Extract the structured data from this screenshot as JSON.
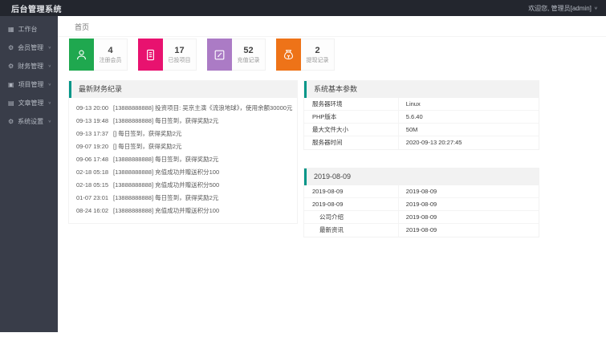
{
  "topbar": {
    "title": "后台管理系统",
    "welcome": "欢迎您, 管理员[admin]",
    "caret": "∨"
  },
  "sidebar": {
    "chevron": "∨",
    "items": [
      {
        "glyph": "▦",
        "label": "工作台"
      },
      {
        "glyph": "⚙",
        "label": "会员管理"
      },
      {
        "glyph": "⚙",
        "label": "财务管理"
      },
      {
        "glyph": "▣",
        "label": "项目管理"
      },
      {
        "glyph": "▤",
        "label": "文章管理"
      },
      {
        "glyph": "⚙",
        "label": "系统设置"
      }
    ]
  },
  "breadcrumb": "首页",
  "stat_cards": [
    {
      "value": "4",
      "label": "注册会员",
      "color": "#1fa84f",
      "icon": "user-icon"
    },
    {
      "value": "17",
      "label": "已投项目",
      "color": "#e8126f",
      "icon": "document-icon"
    },
    {
      "value": "52",
      "label": "充值记录",
      "color": "#ab7bc5",
      "icon": "edit-icon"
    },
    {
      "value": "2",
      "label": "提现记录",
      "color": "#ee7318",
      "icon": "money-bag-icon"
    }
  ],
  "accent_color": "#009688",
  "finance_panel": {
    "title": "最新财务纪录",
    "records": [
      {
        "time": "09-13 20:00",
        "text": "[13888888888] 投资项目: 吴京主演《流浪地球》，使用余额30000元"
      },
      {
        "time": "09-13 19:48",
        "text": "[13888888888] 每日签到，获得奖励2元"
      },
      {
        "time": "09-13 17:37",
        "text": "[] 每日签到，获得奖励2元"
      },
      {
        "time": "09-07 19:20",
        "text": "[] 每日签到，获得奖励2元"
      },
      {
        "time": "09-06 17:48",
        "text": "[13888888888] 每日签到，获得奖励2元"
      },
      {
        "time": "02-18 05:18",
        "text": "[13888888888] 充值成功并赠送积分100"
      },
      {
        "time": "02-18 05:15",
        "text": "[13888888888] 充值成功并赠送积分500"
      },
      {
        "time": "01-07 23:01",
        "text": "[13888888888] 每日签到，获得奖励2元"
      },
      {
        "time": "08-24 16:02",
        "text": "[13888888888] 充值成功并赠送积分100"
      }
    ]
  },
  "system_panel": {
    "title": "系统基本参数",
    "rows": [
      {
        "label": "服务器环境",
        "value": "Linux"
      },
      {
        "label": "PHP版本",
        "value": "5.6.40"
      },
      {
        "label": "最大文件大小",
        "value": "50M"
      },
      {
        "label": "服务器时间",
        "value": "2020-09-13 20:27:45"
      }
    ]
  },
  "articles_panel": {
    "title": "2019-08-09",
    "rows": [
      {
        "label": "2019-08-09",
        "value": "2019-08-09"
      },
      {
        "label": "2019-08-09",
        "value": "2019-08-09"
      },
      {
        "label": "公司介绍",
        "value": "2019-08-09"
      },
      {
        "label": "最新资讯",
        "value": "2019-08-09"
      }
    ]
  }
}
